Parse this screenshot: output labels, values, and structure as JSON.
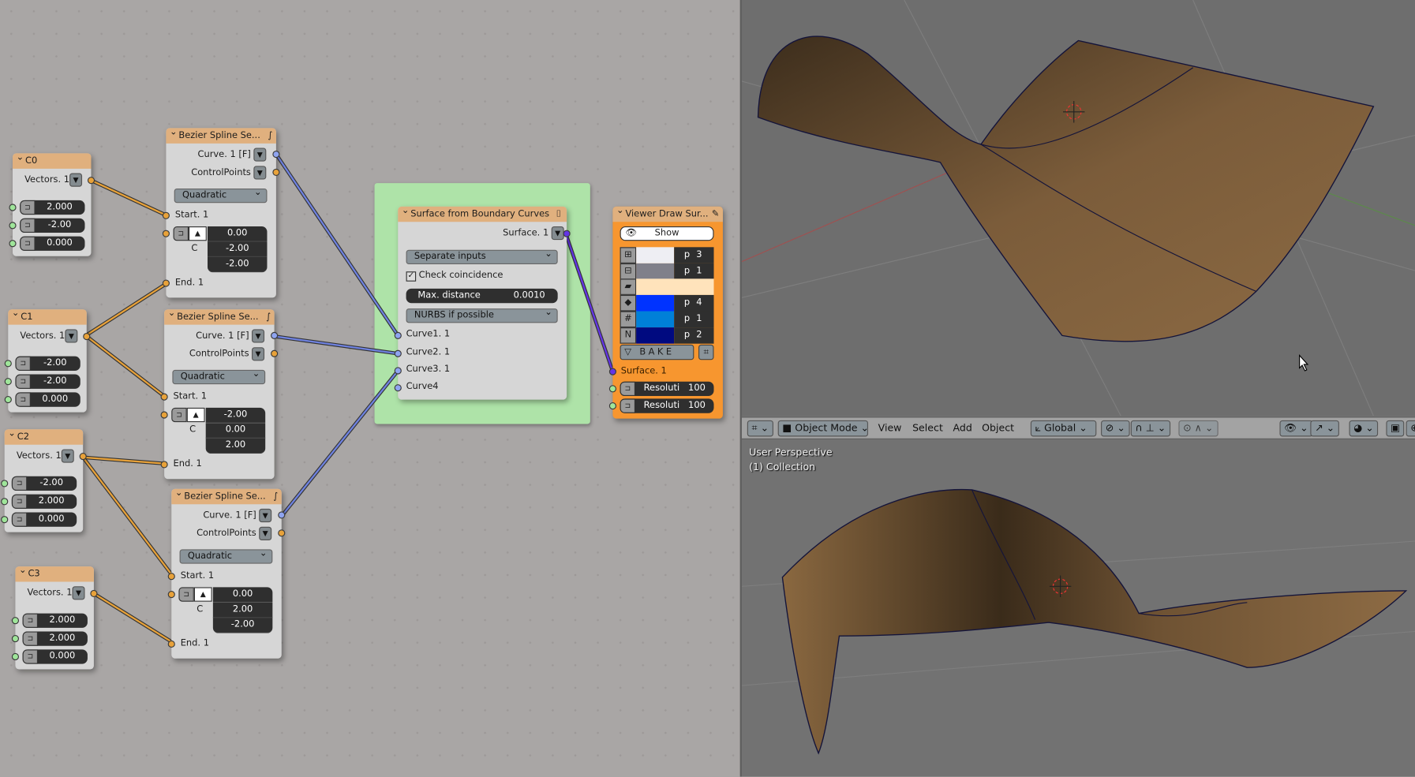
{
  "colors": {
    "canvas": "#a9a6a5",
    "node_header": "#e0b07e",
    "frame": "#aee3a8",
    "viewer_body": "#f7962f",
    "wire_orange": "#e8a23a",
    "wire_blue": "#6f82e0",
    "wire_purple": "#6435e6",
    "surface": "#7b5c3a"
  },
  "vector_nodes": [
    {
      "title": "C0",
      "output": "Vectors. 1",
      "values": [
        "2.000",
        "-2.00",
        "0.000"
      ]
    },
    {
      "title": "C1",
      "output": "Vectors. 1",
      "values": [
        "-2.00",
        "-2.00",
        "0.000"
      ]
    },
    {
      "title": "C2",
      "output": "Vectors. 1",
      "values": [
        "-2.00",
        "2.000",
        "0.000"
      ]
    },
    {
      "title": "C3",
      "output": "Vectors. 1",
      "values": [
        "2.000",
        "2.000",
        "0.000"
      ]
    }
  ],
  "bezier_nodes": [
    {
      "title": "Bezier Spline Se...",
      "out1": "Curve. 1 [F]",
      "out2": "ControlPoints",
      "mode": "Quadratic",
      "start": "Start. 1",
      "c_label": "C",
      "c_values": [
        "0.00",
        "-2.00",
        "-2.00"
      ],
      "end": "End. 1"
    },
    {
      "title": "Bezier Spline Se...",
      "out1": "Curve. 1 [F]",
      "out2": "ControlPoints",
      "mode": "Quadratic",
      "start": "Start. 1",
      "c_label": "C",
      "c_values": [
        "-2.00",
        "0.00",
        "2.00"
      ],
      "end": "End. 1"
    },
    {
      "title": "Bezier Spline Se...",
      "out1": "Curve. 1 [F]",
      "out2": "ControlPoints",
      "mode": "Quadratic",
      "start": "Start. 1",
      "c_label": "C",
      "c_values": [
        "0.00",
        "2.00",
        "-2.00"
      ],
      "end": "End. 1"
    }
  ],
  "surface_node": {
    "title": "Surface from Boundary Curves",
    "output": "Surface. 1",
    "input_mode": "Separate inputs",
    "check_label": "Check coincidence",
    "check_checked": true,
    "max_distance_label": "Max. distance",
    "max_distance": "0.0010",
    "nurbs_mode": "NURBS if possible",
    "inputs": [
      "Curve1. 1",
      "Curve2. 1",
      "Curve3. 1",
      "Curve4"
    ]
  },
  "viewer_node": {
    "title": "Viewer Draw Sur...",
    "show_label": "Show",
    "rows": [
      {
        "icon": "vertex-icon",
        "color": "#eeeef3",
        "label": "p 3"
      },
      {
        "icon": "edge-icon",
        "color": "#80808a",
        "label": "p 1"
      },
      {
        "icon": "face-icon",
        "color": "#ffe3bb",
        "label": ""
      },
      {
        "icon": "diamond-icon",
        "color": "#0033ff",
        "label": "p 4"
      },
      {
        "icon": "grid-icon",
        "color": "#0080d8",
        "label": "p 1"
      },
      {
        "icon": "normal-icon",
        "color": "#000a80",
        "label": "p 2"
      }
    ],
    "bake_label": "BAKE",
    "input": "Surface. 1",
    "resolutions": [
      {
        "label": "Resoluti",
        "value": "100"
      },
      {
        "label": "Resoluti",
        "value": "100"
      }
    ]
  },
  "viewport": {
    "mode": "Object Mode",
    "menus": [
      "View",
      "Select",
      "Add",
      "Object"
    ],
    "orientation": "Global",
    "perspective": "User Perspective",
    "collection": "(1) Collection"
  }
}
